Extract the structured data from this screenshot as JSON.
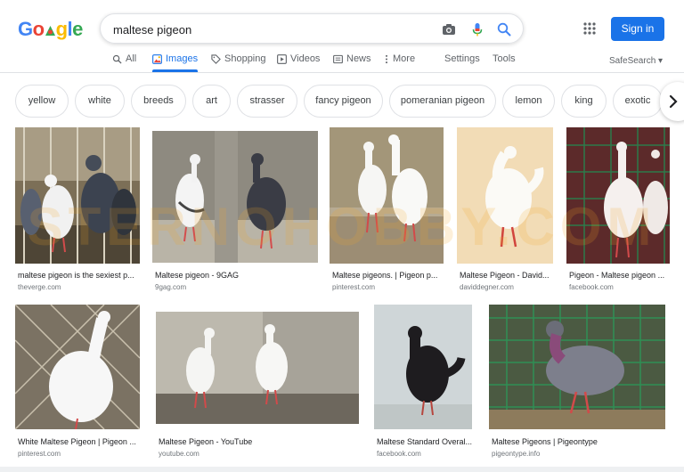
{
  "search": {
    "query": "maltese pigeon"
  },
  "header": {
    "sign_in": "Sign in"
  },
  "tabs": [
    {
      "label": "All",
      "icon": "search-icon"
    },
    {
      "label": "Images",
      "icon": "image-icon",
      "active": true
    },
    {
      "label": "Shopping",
      "icon": "tag-icon"
    },
    {
      "label": "Videos",
      "icon": "play-icon"
    },
    {
      "label": "News",
      "icon": "news-icon"
    },
    {
      "label": "More",
      "icon": "more-vert-icon"
    },
    {
      "label": "Settings"
    },
    {
      "label": "Tools"
    }
  ],
  "safe_search": "SafeSearch ▾",
  "chips": [
    "yellow",
    "white",
    "breeds",
    "art",
    "strasser",
    "fancy pigeon",
    "pomeranian pigeon",
    "lemon",
    "king",
    "exotic"
  ],
  "results": [
    {
      "caption": "maltese pigeon is the sexiest p...",
      "source": "theverge.com"
    },
    {
      "caption": "Maltese pigeon - 9GAG",
      "source": "9gag.com"
    },
    {
      "caption": "Maltese pigeons. | Pigeon p...",
      "source": "pinterest.com"
    },
    {
      "caption": "Maltese Pigeon - David...",
      "source": "daviddegner.com"
    },
    {
      "caption": "Pigeon - Maltese pigeon ...",
      "source": "facebook.com"
    },
    {
      "caption": "White Maltese Pigeon | Pigeon ...",
      "source": "pinterest.com"
    },
    {
      "caption": "Maltese Pigeon - YouTube",
      "source": "youtube.com"
    },
    {
      "caption": "Maltese Standard Overal...",
      "source": "facebook.com"
    },
    {
      "caption": "Maltese Pigeons | Pigeontype",
      "source": "pigeontype.info"
    }
  ],
  "watermark": "STERNOHOBBY.COM",
  "colors": {
    "accent": "#1a73e8",
    "caption_source": "#70757a",
    "chip_border": "#dfe1e5"
  }
}
